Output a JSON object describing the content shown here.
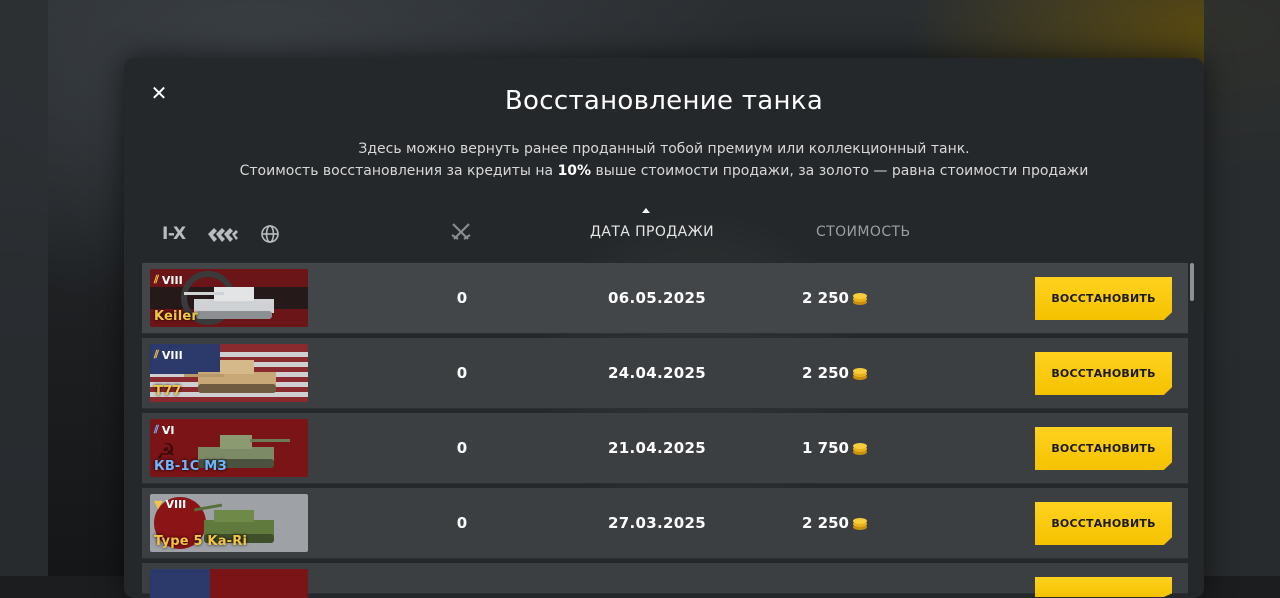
{
  "modal": {
    "title": "Восстановление танка",
    "description_line1": "Здесь можно вернуть ранее проданный тобой премиум или коллекционный танк.",
    "description_line2_pre": "Стоимость восстановления за кредиты на ",
    "description_line2_bold": "10%",
    "description_line2_post": " выше стоимости продажи, за золото — равна стоимости продажи"
  },
  "filters": {
    "tier_label": "I-X",
    "icons": [
      "tank-type-filter-icon",
      "nation-globe-icon"
    ]
  },
  "columns": {
    "battles_icon": "crossed-swords-icon",
    "date": "ДАТА ПРОДАЖИ",
    "cost": "СТОИМОСТЬ",
    "sort": "ascending-arrow"
  },
  "rows": [
    {
      "tier": "VIII",
      "name": "Keiler",
      "name_color": "#f5c542",
      "flag": "germany",
      "battles": "0",
      "date": "06.05.2025",
      "cost": "2 250",
      "button": "ВОССТАНОВИТЬ"
    },
    {
      "tier": "VIII",
      "name": "T77",
      "name_color": "#f5c542",
      "flag": "usa",
      "battles": "0",
      "date": "24.04.2025",
      "cost": "2 250",
      "button": "ВОССТАНОВИТЬ"
    },
    {
      "tier": "VI",
      "name": "КВ-1С МЗ",
      "name_color": "#6fb6ff",
      "flag": "ussr",
      "battles": "0",
      "date": "21.04.2025",
      "cost": "1 750",
      "button": "ВОССТАНОВИТЬ"
    },
    {
      "tier": "VIII",
      "name": "Type 5 Ka-Ri",
      "name_color": "#f5c542",
      "flag": "japan",
      "battles": "0",
      "date": "27.03.2025",
      "cost": "2 250",
      "button": "ВОССТАНОВИТЬ"
    }
  ],
  "colors": {
    "accent": "#ffd21f",
    "gold": "#f3b51c",
    "panel": "#25282a"
  }
}
